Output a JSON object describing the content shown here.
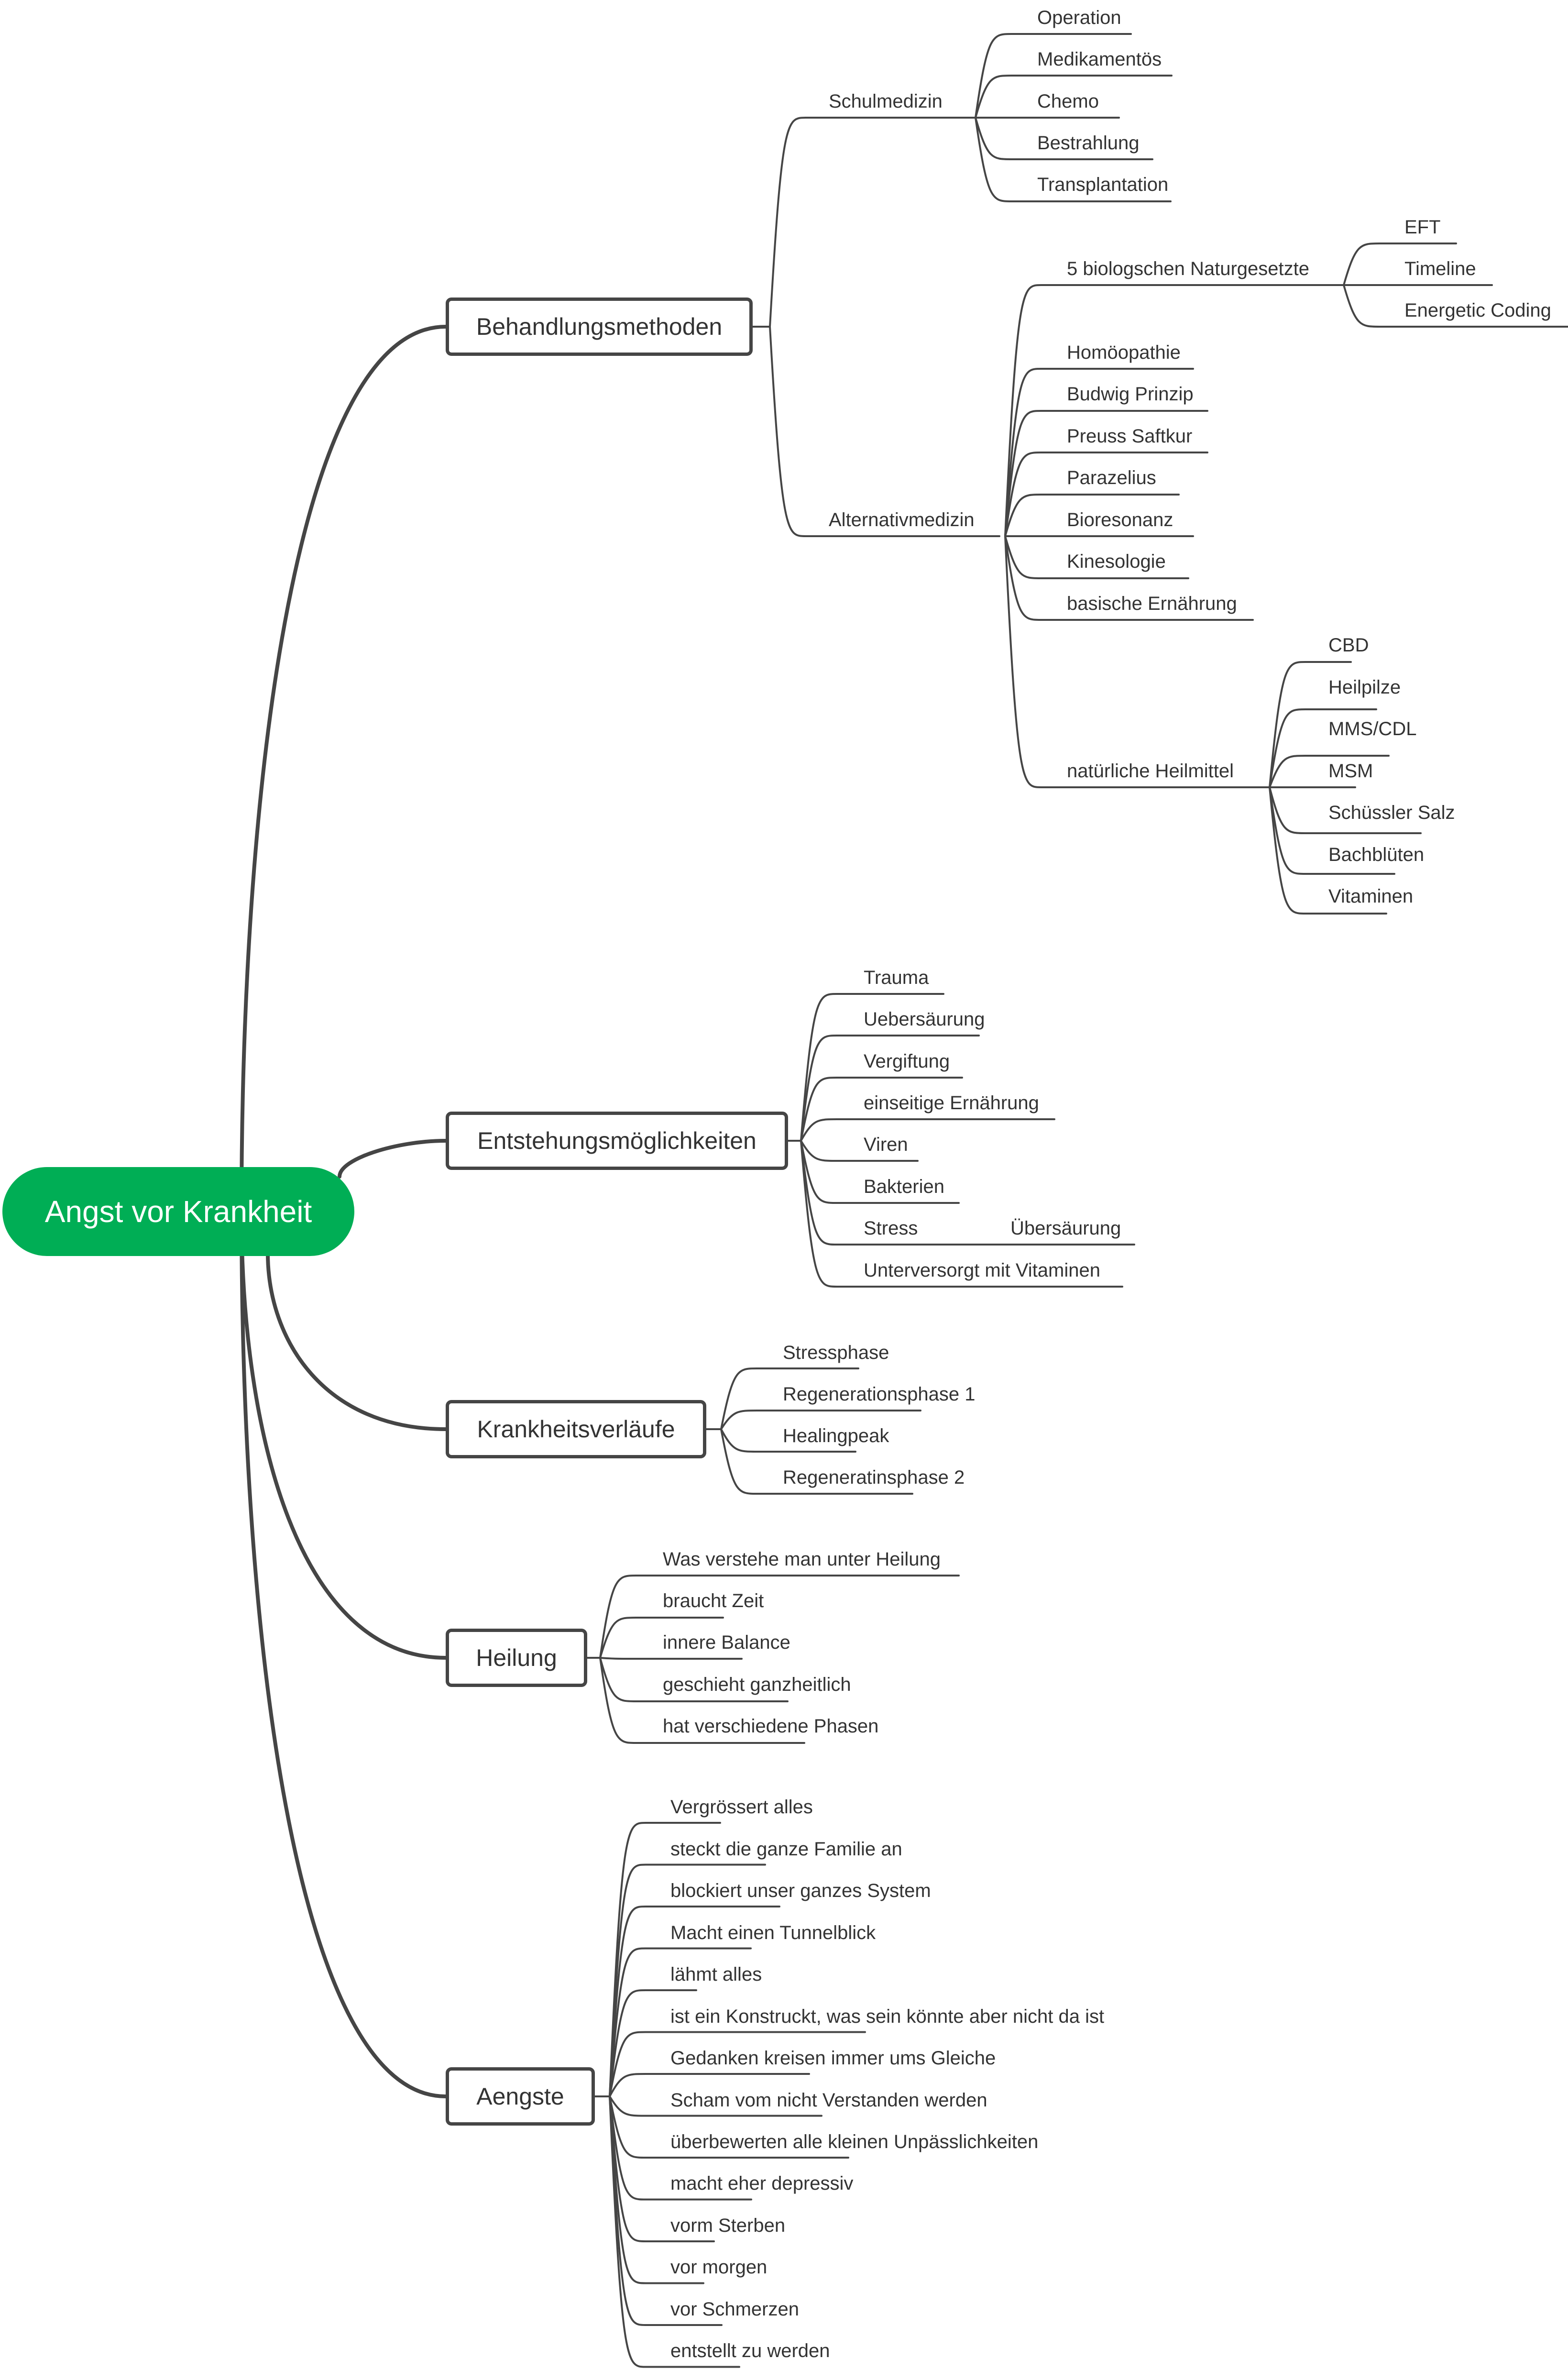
{
  "colors": {
    "root_fill": "#00AE55",
    "root_text": "#FFFFFF",
    "line": "#454545",
    "text": "#333333"
  },
  "mindmap": {
    "root": "Angst vor Krankheit",
    "branches": [
      {
        "label": "Behandlungsmethoden",
        "children": [
          {
            "label": "Schulmedizin",
            "children": [
              {
                "label": "Operation"
              },
              {
                "label": "Medikamentös"
              },
              {
                "label": "Chemo"
              },
              {
                "label": "Bestrahlung"
              },
              {
                "label": "Transplantation"
              }
            ]
          },
          {
            "label": "Alternativmedizin",
            "children": [
              {
                "label": "5 biologschen Naturgesetzte",
                "children": [
                  {
                    "label": "EFT"
                  },
                  {
                    "label": "Timeline"
                  },
                  {
                    "label": "Energetic Coding"
                  }
                ]
              },
              {
                "label": "Homöopathie"
              },
              {
                "label": "Budwig Prinzip"
              },
              {
                "label": "Preuss Saftkur"
              },
              {
                "label": "Parazelius"
              },
              {
                "label": "Bioresonanz"
              },
              {
                "label": "Kinesologie"
              },
              {
                "label": "basische Ernährung"
              },
              {
                "label": "natürliche Heilmittel",
                "children": [
                  {
                    "label": "CBD"
                  },
                  {
                    "label": "Heilpilze"
                  },
                  {
                    "label": "MMS/CDL"
                  },
                  {
                    "label": "MSM"
                  },
                  {
                    "label": "Schüssler Salz"
                  },
                  {
                    "label": "Bachblüten"
                  },
                  {
                    "label": "Vitaminen"
                  }
                ]
              }
            ]
          }
        ]
      },
      {
        "label": "Entstehungsmöglichkeiten",
        "children": [
          {
            "label": "Trauma"
          },
          {
            "label": "Uebersäurung"
          },
          {
            "label": "Vergiftung"
          },
          {
            "label": "einseitige Ernährung"
          },
          {
            "label": "Viren"
          },
          {
            "label": "Bakterien"
          },
          {
            "label": "Stress",
            "children": [
              {
                "label": "Übersäurung"
              }
            ]
          },
          {
            "label": "Unterversorgt mit Vitaminen"
          }
        ]
      },
      {
        "label": "Krankheitsverläufe",
        "children": [
          {
            "label": "Stressphase"
          },
          {
            "label": "Regenerationsphase 1"
          },
          {
            "label": "Healingpeak"
          },
          {
            "label": "Regeneratinsphase 2"
          }
        ]
      },
      {
        "label": "Heilung",
        "children": [
          {
            "label": "Was verstehe man unter Heilung"
          },
          {
            "label": "braucht Zeit"
          },
          {
            "label": "innere Balance"
          },
          {
            "label": "geschieht ganzheitlich"
          },
          {
            "label": "hat verschiedene Phasen"
          }
        ]
      },
      {
        "label": "Aengste",
        "children": [
          {
            "label": "Vergrössert alles"
          },
          {
            "label": "steckt die ganze Familie an"
          },
          {
            "label": "blockiert unser ganzes System"
          },
          {
            "label": "Macht einen Tunnelblick"
          },
          {
            "label": "lähmt alles"
          },
          {
            "label": "ist ein Konstruckt, was sein könnte aber nicht da ist"
          },
          {
            "label": "Gedanken kreisen immer ums Gleiche"
          },
          {
            "label": "Scham vom nicht Verstanden werden"
          },
          {
            "label": "überbewerten alle kleinen Unpässlichkeiten"
          },
          {
            "label": "macht eher depressiv"
          },
          {
            "label": "vorm Sterben"
          },
          {
            "label": "vor morgen"
          },
          {
            "label": "vor Schmerzen"
          },
          {
            "label": "entstellt zu werden"
          }
        ]
      }
    ]
  }
}
